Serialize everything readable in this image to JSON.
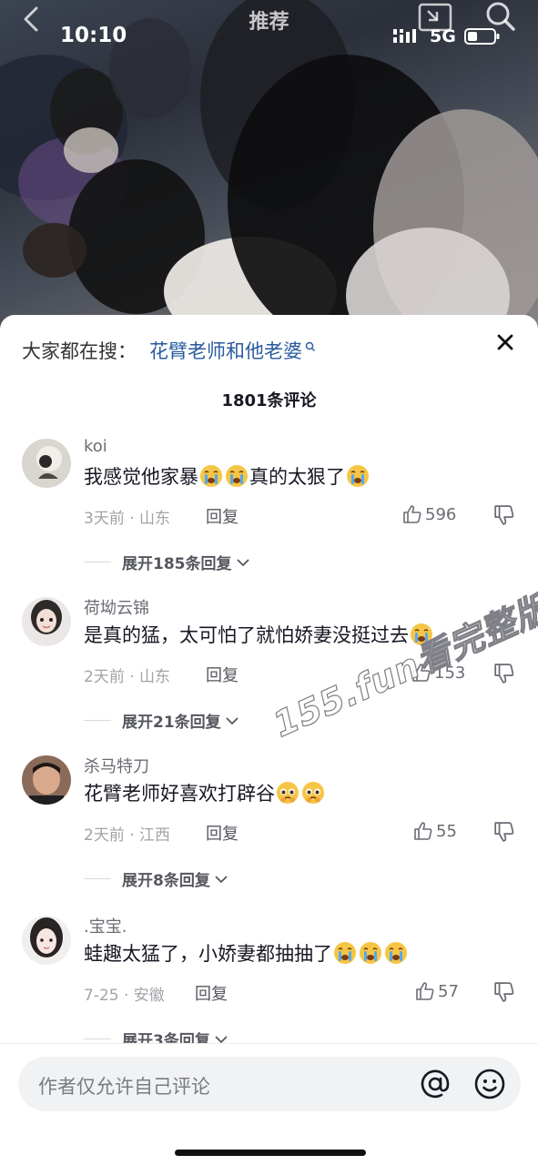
{
  "status_bar": {
    "time": "10:10",
    "network": "5G",
    "icons": [
      "back-icon",
      "pip-icon",
      "search-icon",
      "signal-icon",
      "battery-icon"
    ]
  },
  "video": {
    "title": "推荐"
  },
  "sheet": {
    "search_prefix": "大家都在搜：",
    "search_term": "花臂老师和他老婆",
    "comment_count": "1801条评论"
  },
  "comments": [
    {
      "username": "koi",
      "text": "我感觉他家暴",
      "text_after": "真的太狠了",
      "emojis_mid": [
        "crying-emoji",
        "crying-emoji"
      ],
      "emojis_end": [
        "crying-emoji"
      ],
      "meta": "3天前 · 山东",
      "reply": "回复",
      "likes": "596",
      "expand": "展开185条回复"
    },
    {
      "username": "荷坳云锦",
      "text": "是真的猛，太可怕了就怕娇妻没挺过去",
      "text_after": "",
      "emojis_end": [
        "crying-emoji"
      ],
      "meta": "2天前 · 山东",
      "reply": "回复",
      "likes": "153",
      "expand": "展开21条回复"
    },
    {
      "username": "杀马特刀",
      "text": "花臂老师好喜欢打辟谷",
      "text_after": "",
      "emojis_end": [
        "pleading-emoji",
        "pleading-emoji"
      ],
      "meta": "2天前 · 江西",
      "reply": "回复",
      "likes": "55",
      "expand": "展开8条回复"
    },
    {
      "username": ".宝宝.",
      "text": "蛙趣太猛了，小娇妻都抽抽了",
      "text_after": "",
      "emojis_end": [
        "crying-emoji",
        "crying-emoji",
        "crying-emoji"
      ],
      "meta": "7-25 · 安徽",
      "reply": "回复",
      "likes": "57",
      "expand": "展开3条回复"
    }
  ],
  "watermark": "155.fun看完整版",
  "input": {
    "placeholder": "作者仅允许自己评论",
    "icons": [
      "at-icon",
      "emoji-icon"
    ]
  },
  "colors": {
    "accent_link": "#2a5b9e",
    "text_primary": "#161823",
    "text_secondary": "#a1a3a8"
  }
}
